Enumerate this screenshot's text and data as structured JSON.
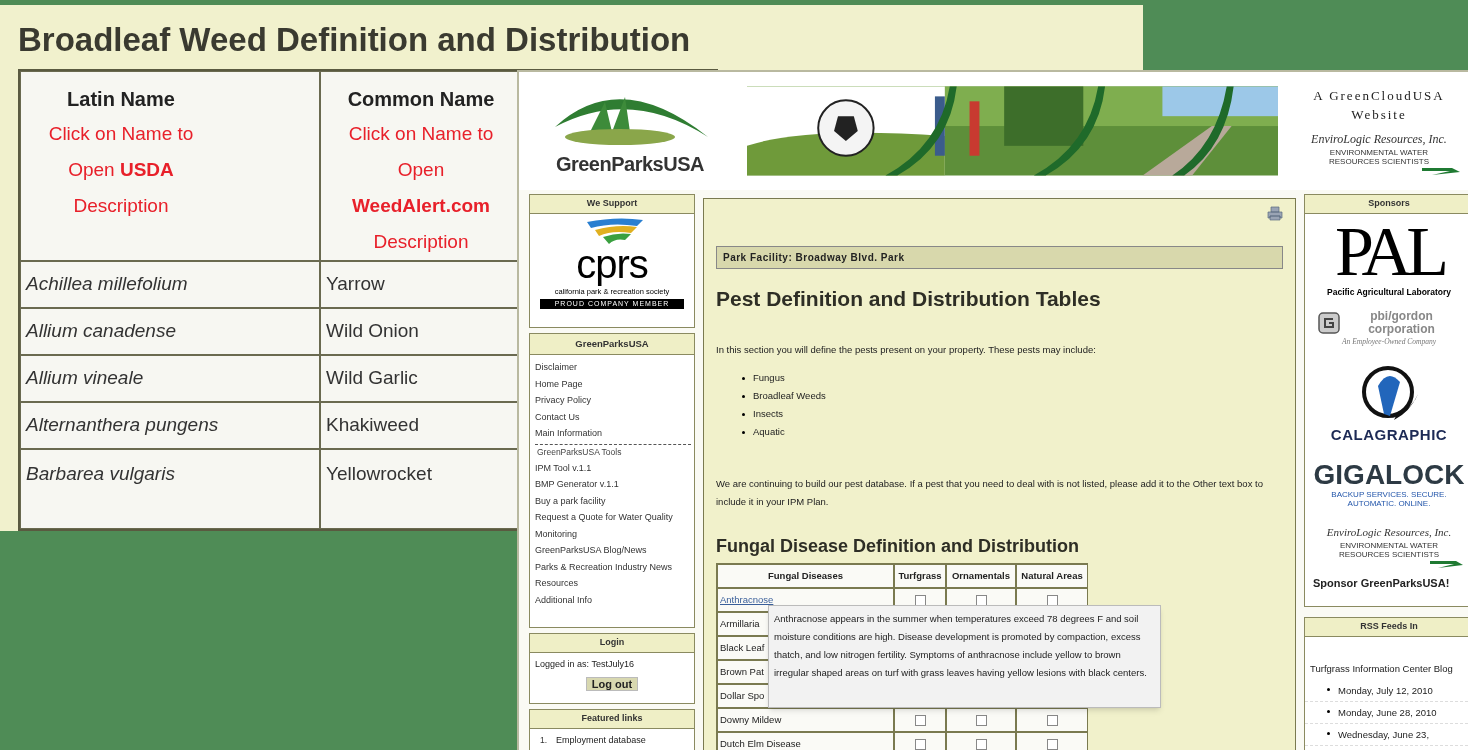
{
  "back_panel": {
    "title": "Broadleaf Weed Definition and Distribution",
    "columns": [
      {
        "title": "Latin Name",
        "note": "Click on Name to Open **USDA** Description"
      },
      {
        "title": "Common Name",
        "note": "Click on Name to Open **WeedAlert.com** Description"
      }
    ],
    "rows": [
      {
        "latin": "Achillea millefolium",
        "common": "Yarrow"
      },
      {
        "latin": "Allium canadense",
        "common": "Wild Onion"
      },
      {
        "latin": "Allium vineale",
        "common": "Wild Garlic"
      },
      {
        "latin": "Alternanthera pungens",
        "common": "Khakiweed"
      },
      {
        "latin": "Barbarea vulgaris",
        "common": "Yellowrocket"
      }
    ]
  },
  "site": {
    "header": {
      "logo_text": "GreenParksUSA",
      "tagline": "A GreenCloudUSA Website",
      "partner": "EnviroLogic Resources, Inc.",
      "partner_subtext": "ENVIRONMENTAL WATER RESOURCES SCIENTISTS"
    },
    "we_support": {
      "title": "We Support",
      "logo": "cprs",
      "caption": "california park & recreation society",
      "badge": "PROUD COMPANY MEMBER"
    },
    "nav": {
      "title": "GreenParksUSA",
      "items": [
        {
          "label": "Disclaimer",
          "kind": "link"
        },
        {
          "label": "Home Page",
          "kind": "link"
        },
        {
          "label": "Privacy Policy",
          "kind": "link"
        },
        {
          "label": "Contact Us",
          "kind": "link"
        },
        {
          "label": "Main Information",
          "kind": "link"
        },
        {
          "label": "GreenParksUSA Tools",
          "kind": "heading"
        },
        {
          "label": "IPM Tool v.1.1",
          "kind": "link"
        },
        {
          "label": "BMP Generator v.1.1",
          "kind": "link"
        },
        {
          "label": "Buy a park facility",
          "kind": "link"
        },
        {
          "label": "Request a Quote for Water Quality Monitoring",
          "kind": "link"
        },
        {
          "label": "GreenParksUSA Blog/News",
          "kind": "link"
        },
        {
          "label": "Parks & Recreation Industry News",
          "kind": "link"
        },
        {
          "label": "Resources",
          "kind": "link"
        },
        {
          "label": "Additional Info",
          "kind": "link"
        }
      ]
    },
    "login": {
      "title": "Login",
      "status": "Logged in as: TestJuly16",
      "button": "Log out"
    },
    "featured": {
      "title": "Featured links",
      "items": [
        {
          "number": "1.",
          "label": "Employment database"
        }
      ]
    },
    "main": {
      "facility": "Park Facility: Broadway Blvd. Park",
      "heading": "Pest Definition and Distribution Tables",
      "intro": "In this section you will define the pests present on your property. These pests may include:",
      "pests": [
        "Fungus",
        "Broadleaf Weeds",
        "Insects",
        "Aquatic"
      ],
      "note": "We are continuing to build our pest database. If a pest that you need to deal with is not listed, please add it to the Other text box to include it in your IPM Plan.",
      "section_heading": "Fungal Disease Definition and Distribution",
      "columns": [
        "Fungal Diseases",
        "Turfgrass",
        "Ornamentals",
        "Natural Areas"
      ],
      "rows": [
        {
          "name": "Anthracnose",
          "kind": "link",
          "checks": [
            false,
            false,
            false
          ]
        },
        {
          "name": "Armillaria",
          "kind": "text"
        },
        {
          "name": "Black Leaf",
          "kind": "text"
        },
        {
          "name": "Brown Pat",
          "kind": "text"
        },
        {
          "name": "Dollar Spo",
          "kind": "text"
        },
        {
          "name": "Downy Mildew",
          "kind": "text",
          "checks": [
            false,
            false,
            false
          ]
        },
        {
          "name": "Dutch Elm Disease",
          "kind": "text",
          "checks": [
            false,
            false,
            false
          ]
        }
      ],
      "tooltip": "Anthracnose appears in the summer when temperatures exceed 78 degrees F and soil moisture conditions are high. Disease development is promoted by compaction, excess thatch, and low nitrogen fertility. Symptoms of anthracnose include yellow to brown irregular shaped areas on turf with grass leaves having yellow lesions with black centers."
    },
    "sponsors": {
      "title": "Sponsors",
      "logos": [
        {
          "kind": "pal",
          "text": "PAL",
          "caption": "Pacific Agricultural Laboratory"
        },
        {
          "kind": "pbi",
          "text": "pbi/gordon corporation",
          "caption": "An Employee-Owned Company"
        },
        {
          "kind": "cala",
          "text": "CALAGRAPHIC"
        },
        {
          "kind": "giga",
          "text": "GIGALOCK",
          "caption": "BACKUP SERVICES. SECURE. AUTOMATIC. ONLINE."
        },
        {
          "kind": "enviro",
          "text": "EnviroLogic Resources, Inc.",
          "caption": "ENVIRONMENTAL WATER RESOURCES SCIENTISTS"
        }
      ],
      "link": "Sponsor GreenParksUSA!"
    },
    "rss": {
      "title": "RSS Feeds In",
      "feed": "Turfgrass Information Center Blog",
      "items": [
        "Monday, July 12, 2010",
        "Monday, June 28, 2010",
        "Wednesday, June 23,"
      ]
    }
  }
}
